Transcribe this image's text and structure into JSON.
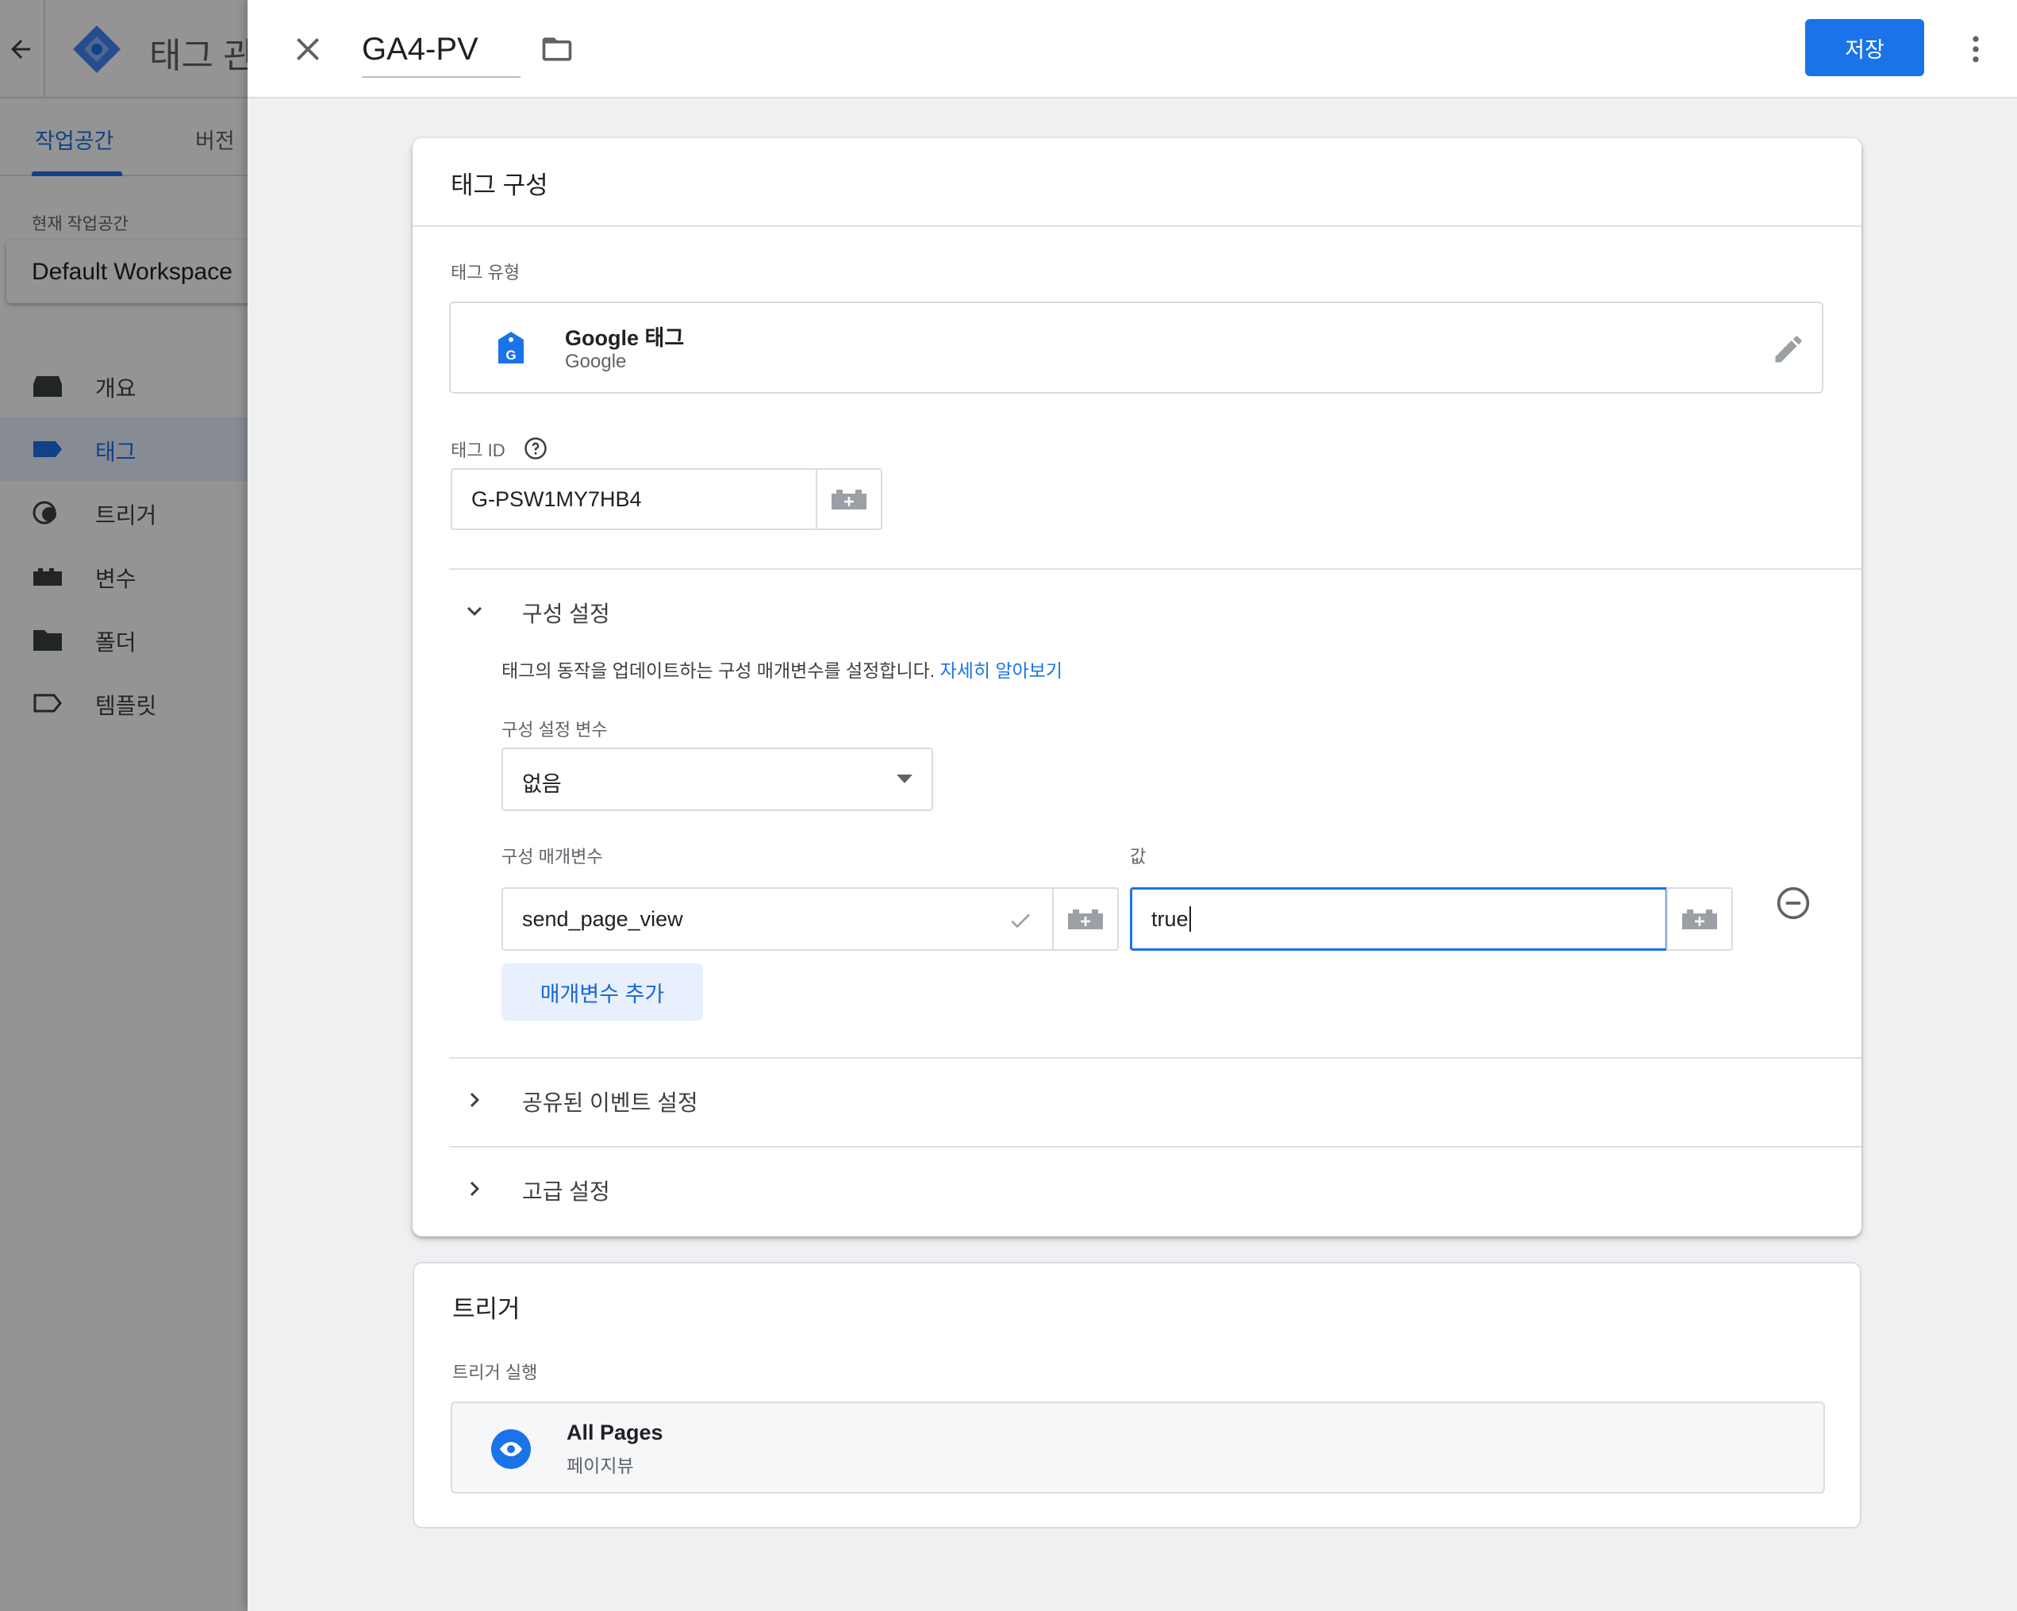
{
  "background_app": {
    "title": "태그 관",
    "tabs": [
      {
        "label": "작업공간",
        "active": true
      },
      {
        "label": "버전",
        "active": false
      }
    ],
    "workspace_label": "현재 작업공간",
    "workspace_name": "Default Workspace",
    "nav": [
      {
        "label": "개요",
        "icon": "overview-icon"
      },
      {
        "label": "태그",
        "icon": "tag-icon",
        "active": true
      },
      {
        "label": "트리거",
        "icon": "trigger-icon"
      },
      {
        "label": "변수",
        "icon": "variable-icon"
      },
      {
        "label": "폴더",
        "icon": "folder-icon"
      },
      {
        "label": "템플릿",
        "icon": "template-icon"
      }
    ]
  },
  "editor": {
    "tag_name": "GA4-PV",
    "save_label": "저장"
  },
  "tag_config": {
    "title": "태그 구성",
    "tag_type_label": "태그 유형",
    "tag_type": {
      "name": "Google 태그",
      "vendor": "Google"
    },
    "tag_id_label": "태그 ID",
    "tag_id_value": "G-PSW1MY7HB4",
    "config_section": {
      "title": "구성 설정",
      "description": "태그의 동작을 업데이트하는 구성 매개변수를 설정합니다.",
      "learn_more": "자세히 알아보기",
      "variable_label": "구성 설정 변수",
      "variable_value": "없음",
      "param_label": "구성 매개변수",
      "value_label": "값",
      "param_value": "send_page_view",
      "value_value": "true",
      "add_param_label": "매개변수 추가"
    },
    "shared_event_title": "공유된 이벤트 설정",
    "advanced_title": "고급 설정"
  },
  "triggering": {
    "title": "트리거",
    "label": "트리거 실행",
    "trigger_name": "All Pages",
    "trigger_type": "페이지뷰"
  },
  "colors": {
    "accent": "#1a73e8",
    "scrim": "rgba(0,0,0,0.42)"
  }
}
